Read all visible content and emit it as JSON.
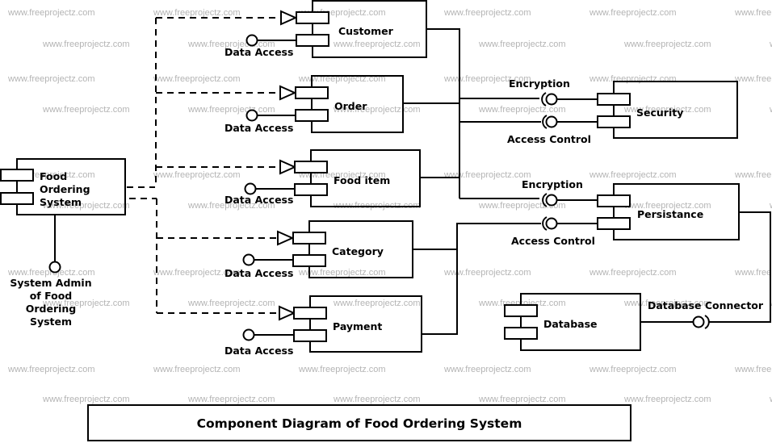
{
  "watermark": "www.freeprojectz.com",
  "title": "Component Diagram of Food Ordering System",
  "system": {
    "name_lines": [
      "Food",
      "Ordering",
      "System"
    ],
    "admin_interface_lines": [
      "System Admin",
      "of Food",
      "Ordering",
      "System"
    ]
  },
  "components": [
    {
      "id": "customer",
      "name": "Customer",
      "interface": "Data Access"
    },
    {
      "id": "order",
      "name": "Order",
      "interface": "Data Access"
    },
    {
      "id": "food-item",
      "name": "Food item",
      "interface": "Data Access"
    },
    {
      "id": "category",
      "name": "Category",
      "interface": "Data Access"
    },
    {
      "id": "payment",
      "name": "Payment",
      "interface": "Data Access"
    }
  ],
  "security": {
    "name": "Security",
    "interfaces": [
      "Encryption",
      "Access Control"
    ]
  },
  "persistance": {
    "name": "Persistance",
    "interfaces": [
      "Encryption",
      "Access Control"
    ]
  },
  "database": {
    "name": "Database",
    "interface": "Database Connector"
  }
}
